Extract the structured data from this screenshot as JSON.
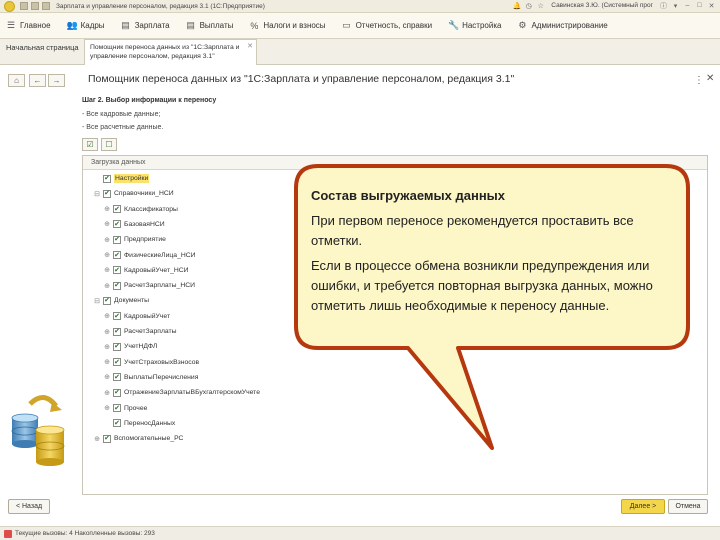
{
  "window": {
    "title": "Зарплата и управление персоналом, редакция 3.1 (1С:Предприятие)",
    "user": "Савинская З.Ю. (Системный прог"
  },
  "sections": [
    {
      "icon": "menu-icon",
      "label": "Главное"
    },
    {
      "icon": "people-icon",
      "label": "Кадры"
    },
    {
      "icon": "list-icon",
      "label": "Зарплата"
    },
    {
      "icon": "list-icon",
      "label": "Выплаты"
    },
    {
      "icon": "percent-icon",
      "label": "Налоги и взносы"
    },
    {
      "icon": "folder-icon",
      "label": "Отчетность, справки"
    },
    {
      "icon": "wrench-icon",
      "label": "Настройка"
    },
    {
      "icon": "gear-icon",
      "label": "Администрирование"
    }
  ],
  "tabs": {
    "home": "Начальная страница",
    "active_line1": "Помощник переноса данных из \"1С:Зарплата и",
    "active_line2": "управление персоналом, редакция 3.1\""
  },
  "page": {
    "title": "Помощник переноса данных из \"1С:Зарплата и управление персоналом, редакция 3.1\"",
    "step": "Шаг 2. Выбор информации к переносу",
    "line1": "- Все кадровые данные;",
    "line2": "- Все расчетные данные."
  },
  "tree": {
    "header": "Загрузка данных",
    "rows": [
      {
        "label": "Настройки",
        "level": 0,
        "expander": "",
        "checked": true,
        "highlight": true
      },
      {
        "label": "Справочники_НСИ",
        "level": 0,
        "expander": "⊟",
        "checked": true
      },
      {
        "label": "Классификаторы",
        "level": 1,
        "expander": "⊕",
        "checked": true
      },
      {
        "label": "БазоваяНСИ",
        "level": 1,
        "expander": "⊕",
        "checked": true
      },
      {
        "label": "Предприятие",
        "level": 1,
        "expander": "⊕",
        "checked": true
      },
      {
        "label": "ФизическиеЛица_НСИ",
        "level": 1,
        "expander": "⊕",
        "checked": true
      },
      {
        "label": "КадровыйУчет_НСИ",
        "level": 1,
        "expander": "⊕",
        "checked": true
      },
      {
        "label": "РасчетЗарплаты_НСИ",
        "level": 1,
        "expander": "⊕",
        "checked": true
      },
      {
        "label": "Документы",
        "level": 0,
        "expander": "⊟",
        "checked": true
      },
      {
        "label": "КадровыйУчет",
        "level": 1,
        "expander": "⊕",
        "checked": true
      },
      {
        "label": "РасчетЗарплаты",
        "level": 1,
        "expander": "⊕",
        "checked": true
      },
      {
        "label": "УчетНДФЛ",
        "level": 1,
        "expander": "⊕",
        "checked": true
      },
      {
        "label": "УчетСтраховыхВзносов",
        "level": 1,
        "expander": "⊕",
        "checked": true
      },
      {
        "label": "ВыплатыПеречисления",
        "level": 1,
        "expander": "⊕",
        "checked": true
      },
      {
        "label": "ОтражениеЗарплатыВБухгалтерскомУчете",
        "level": 1,
        "expander": "⊕",
        "checked": true
      },
      {
        "label": "Прочее",
        "level": 1,
        "expander": "⊕",
        "checked": true
      },
      {
        "label": "ПереносДанных",
        "level": 1,
        "expander": "",
        "checked": true
      },
      {
        "label": "Вспомогательные_РС",
        "level": 0,
        "expander": "⊕",
        "checked": true
      }
    ]
  },
  "buttons": {
    "back": "< Назад",
    "next": "Далее >",
    "cancel": "Отмена"
  },
  "status": {
    "text": "Текущие вызовы: 4   Накопленные вызовы: 293"
  },
  "callout": {
    "title": "Состав выгружаемых данных",
    "p1": "При первом переносе рекомендуется проставить все отметки.",
    "p2": "Если в процессе обмена возникли предупреждения или ошибки, и требуется повторная выгрузка данных, можно отметить лишь необходимые к переносу данные."
  },
  "colors": {
    "callout_border": "#b5380f",
    "callout_fill": "#fdf7c8",
    "highlight": "#fce26a",
    "primary_button": "#f4d64b"
  }
}
